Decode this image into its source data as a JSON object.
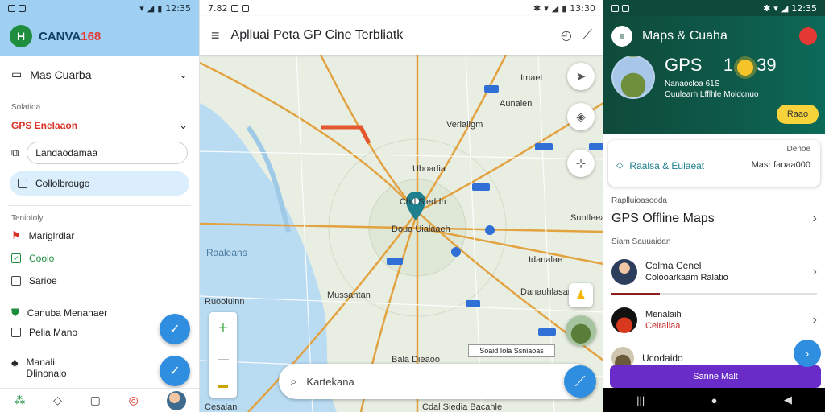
{
  "left": {
    "status": {
      "time": "",
      "battery": "12:35"
    },
    "header": {
      "logo_text": "H",
      "app_name": "CANVA",
      "app_name_suffix": "168"
    },
    "menu_title": "Mas Cuarba",
    "section1_label": "Solatioa",
    "gps_item": "GPS Enelaaon",
    "input_value": "Landaodamaa",
    "selected_pill": "Collolbrougo",
    "section2_label": "Teniotoly",
    "checks": [
      {
        "label": "Mariglrdlar",
        "checked": false,
        "icon": "box-icon"
      },
      {
        "label": "Coolo",
        "checked": true,
        "icon": "check-icon"
      },
      {
        "label": "Sarioe",
        "checked": false,
        "icon": "box-icon"
      }
    ],
    "list_items": [
      "Canuba Menanaer",
      "Pelia Mano"
    ],
    "bottom_item": {
      "line1": "Manali",
      "line2": "Dlinonalo"
    },
    "fab_icons": [
      "check-icon",
      "check-icon"
    ],
    "nav_icons": [
      "map-icon",
      "diamond-icon",
      "square-icon",
      "alert-icon",
      "avatar"
    ]
  },
  "middle": {
    "status": {
      "time": "7.82",
      "battery": "13:30"
    },
    "title": "Aplluai Peta GP Cine Terbliatk",
    "map_labels": {
      "top1": "Imaet",
      "top2": "Aunalen",
      "center_upper": "Verlaligm",
      "center": "Uboadia",
      "city": "Chrl Sieddh",
      "city2": "Doua Uialaaeh",
      "water": "Raaleans",
      "lower": "Mussantan",
      "right": "Suntleeac",
      "right2": "Idanalae",
      "bottom": "Bala Dieaoo",
      "bottom2": "Danauhlasan",
      "bottom_left": "Ruooluinn",
      "bottom_left2": "Cesalan",
      "bottom_center": "Cdal Siedia Bacahle"
    },
    "scale_text": "Soaid Iola Ssniaoas",
    "search_placeholder": "Kartekana",
    "zoom_in": "+",
    "zoom_out": "—"
  },
  "right": {
    "status": {
      "time": "",
      "battery": "12:35"
    },
    "title": "Maps & Cuaha",
    "weather": {
      "gps": "GPS",
      "temp": "1",
      "temp2": "39",
      "line1": "Nanaocloa 61S",
      "line2": "Ouulearh Lfflhle Moldcnuo"
    },
    "yellow_button": "Raao",
    "card": {
      "corner": "Denoe",
      "left": "Raalsa & Eulaeat",
      "right": "Masr faoaa000"
    },
    "section1": "Raplluioasooda",
    "main_item": "GPS Offline Maps",
    "section2": "Siam Sauuaidan",
    "items": [
      {
        "title": "Colma Cenel",
        "sub": "Colooarkaam Ralatio"
      },
      {
        "title": "Menalaih",
        "sub": "Ceiraliaa"
      },
      {
        "title": "Ucodaido",
        "sub": ""
      }
    ],
    "purple_button": "Sanne Malt",
    "nav": [
      "recents-icon",
      "home-icon",
      "back-icon"
    ]
  },
  "colors": {
    "left_header": "#9fd0f2",
    "right_header": "#0f4a3a",
    "fab_blue": "#2f8ee0",
    "purple": "#6a2cc8",
    "yellow": "#f6d33b"
  }
}
